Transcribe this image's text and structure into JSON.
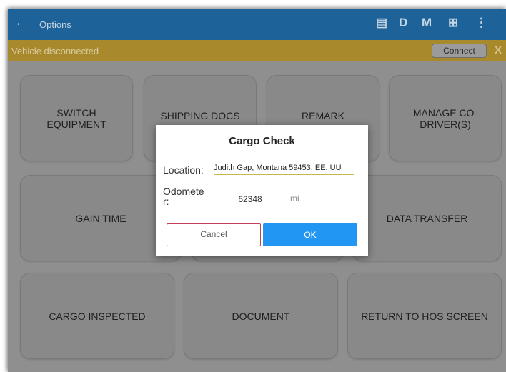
{
  "appbar": {
    "title": "Options",
    "back_glyph": "←",
    "actions": [
      {
        "name": "message-icon",
        "glyph": "▤"
      },
      {
        "name": "d-button",
        "label": "D"
      },
      {
        "name": "m-button",
        "label": "M"
      },
      {
        "name": "download-icon",
        "glyph": "⊞"
      },
      {
        "name": "overflow-menu-icon",
        "glyph": "⋮"
      }
    ]
  },
  "banner": {
    "message": "Vehicle disconnected",
    "connect_label": "Connect",
    "close_label": "X"
  },
  "tiles": {
    "switch_equipment": "SWITCH EQUIPMENT",
    "shipping_docs": "SHIPPING DOCS",
    "remark": "REMARK",
    "manage_codriver": "MANAGE CO-DRIVER(S)",
    "gain_time": "GAIN TIME",
    "data_transfer": "DATA TRANSFER",
    "cargo_inspected": "CARGO INSPECTED",
    "document": "DOCUMENT",
    "return_hos": "RETURN TO HOS SCREEN"
  },
  "dialog": {
    "title": "Cargo Check",
    "location_label": "Location:",
    "location_value": "Judith Gap, Montana 59453, EE. UU",
    "odometer_label": "Odomete r:",
    "odometer_value": "62348",
    "odometer_unit": "mi",
    "cancel_label": "Cancel",
    "ok_label": "OK"
  },
  "colors": {
    "appbar": "#1d6299",
    "banner": "#a88a2c",
    "ok_button": "#2196f3",
    "cancel_border": "#c43e59"
  }
}
